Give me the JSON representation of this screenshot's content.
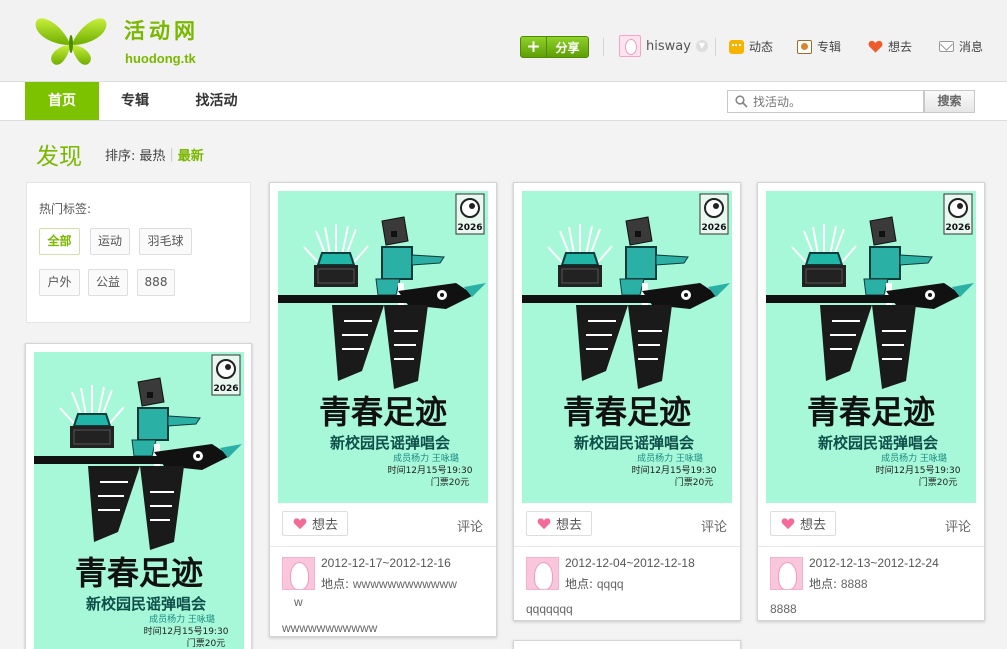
{
  "logo": {
    "title": "活动网",
    "subtitle": "huodong.tk"
  },
  "header": {
    "share_label": "分享",
    "username": "hisway",
    "links": [
      {
        "label": "动态",
        "icon": "dynamics-icon"
      },
      {
        "label": "专辑",
        "icon": "album-icon"
      },
      {
        "label": "想去",
        "icon": "heart-icon"
      },
      {
        "label": "消息",
        "icon": "mail-icon"
      }
    ]
  },
  "nav": {
    "tabs": [
      "首页",
      "专辑",
      "找活动"
    ],
    "active_tab": "首页",
    "search_placeholder": "找活动。",
    "search_button": "搜索"
  },
  "discover": {
    "title": "发现",
    "sort_label": "排序:",
    "sort_hot": "最热",
    "sort_new": "最新"
  },
  "tags": {
    "title": "热门标签:",
    "items": [
      "全部",
      "运动",
      "羽毛球",
      "户外",
      "公益",
      "888"
    ],
    "active": "全部"
  },
  "poster": {
    "headline": "青春足迹",
    "subline": "新校园民谣弹唱会",
    "performers": "成员杨力 王咏璐",
    "time": "时间12月15号19:30",
    "ticket": "门票20元",
    "badge": "2026"
  },
  "cards": [
    {
      "want_label": "想去",
      "comment_label": "评论",
      "date": "2012-12-17~2012-12-16",
      "place_label": "地点:",
      "place": "wwwwwwwwwwww",
      "place_wrap": "w",
      "desc": "wwwwwwwwwww"
    },
    {
      "want_label": "想去",
      "comment_label": "评论",
      "date": "2012-12-04~2012-12-18",
      "place_label": "地点:",
      "place": "qqqq",
      "desc": "qqqqqqq"
    },
    {
      "want_label": "想去",
      "comment_label": "评论",
      "date": "2012-12-13~2012-12-24",
      "place_label": "地点:",
      "place": "8888",
      "desc": "8888"
    }
  ],
  "colors": {
    "brand_green": "#7ab800",
    "poster_bg": "#a7f7d9",
    "heart": "#f36b97"
  }
}
